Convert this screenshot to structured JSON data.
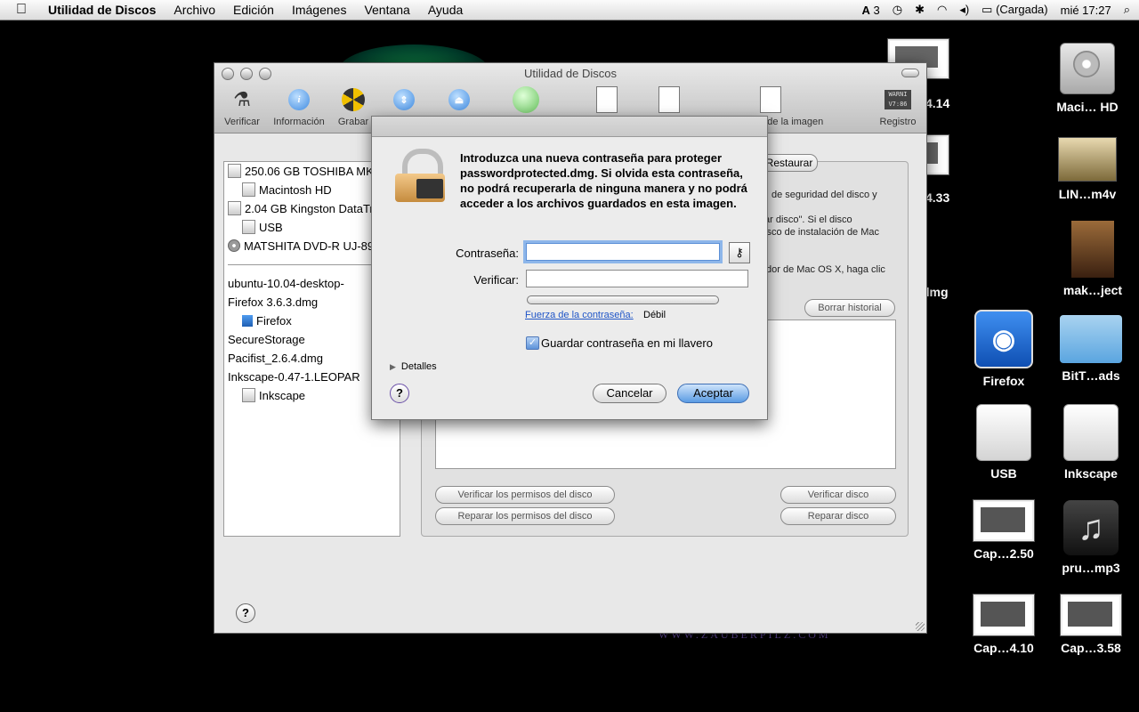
{
  "menubar": {
    "app_name": "Utilidad de Discos",
    "items": [
      "Archivo",
      "Edición",
      "Imágenes",
      "Ventana",
      "Ayuda"
    ],
    "status": {
      "input_indicator": "3",
      "battery": "(Cargada)",
      "clock": "mié 17:27"
    }
  },
  "desktop": {
    "side_labels": [
      "4.14",
      "4.33",
      "dmg"
    ],
    "icons": [
      {
        "label": "Maci… HD"
      },
      {
        "label": "LIN…m4v"
      },
      {
        "label": "mak…ject"
      },
      {
        "label": "Firefox"
      },
      {
        "label": "BitT…ads"
      },
      {
        "label": "USB"
      },
      {
        "label": "Inkscape"
      },
      {
        "label": "Cap…2.50"
      },
      {
        "label": "pru…mp3"
      },
      {
        "label": "Cap…4.10"
      },
      {
        "label": "Cap…3.58"
      }
    ],
    "watermark": "WWW.ZAUBERPILZ.COM"
  },
  "window": {
    "title": "Utilidad de Discos",
    "toolbar": {
      "verificar": "Verificar",
      "informacion": "Información",
      "grabar": "Grabar",
      "tamano": "ño de la imagen",
      "registro": "Registro",
      "registro_badge": "WARNI\nV7:86"
    },
    "sidebar": {
      "items": [
        "250.06 GB TOSHIBA MK2",
        "Macintosh HD",
        "2.04 GB Kingston DataTr",
        "USB",
        "MATSHITA DVD-R UJ-89",
        "ubuntu-10.04-desktop-",
        "Firefox 3.6.3.dmg",
        "Firefox",
        "SecureStorage",
        "Pacifist_2.6.4.dmg",
        "Inkscape-0.47-1.LEOPAR",
        "Inkscape"
      ]
    },
    "panel": {
      "restaurar_tab": "Restaurar",
      "text_lines": [
        "de seguridad del disco y",
        "ar disco\". Si el disco",
        "isco de instalación de Mac",
        "dor de Mac OS X, haga clic"
      ],
      "borrar_historial": "Borrar historial",
      "verificar_permisos": "Verificar los permisos del disco",
      "reparar_permisos": "Reparar los permisos del disco",
      "verificar_disco": "Verificar disco",
      "reparar_disco": "Reparar disco",
      "help": "?"
    }
  },
  "sheet": {
    "message": "Introduzca una nueva contraseña para proteger passwordprotected.dmg. Si olvida esta contraseña, no podrá recuperarla de ninguna manera y no podrá acceder a los archivos guardados en esta imagen.",
    "password_label": "Contraseña:",
    "password_value": "",
    "verify_label": "Verificar:",
    "verify_value": "",
    "strength_link": "Fuerza de la contraseña:",
    "strength_value": "Débil",
    "strength_fraction": 0,
    "keychain_checked": true,
    "keychain_label": "Guardar contraseña en mi llavero",
    "details_label": "Detalles",
    "cancel_label": "Cancelar",
    "accept_label": "Aceptar",
    "help": "?"
  }
}
